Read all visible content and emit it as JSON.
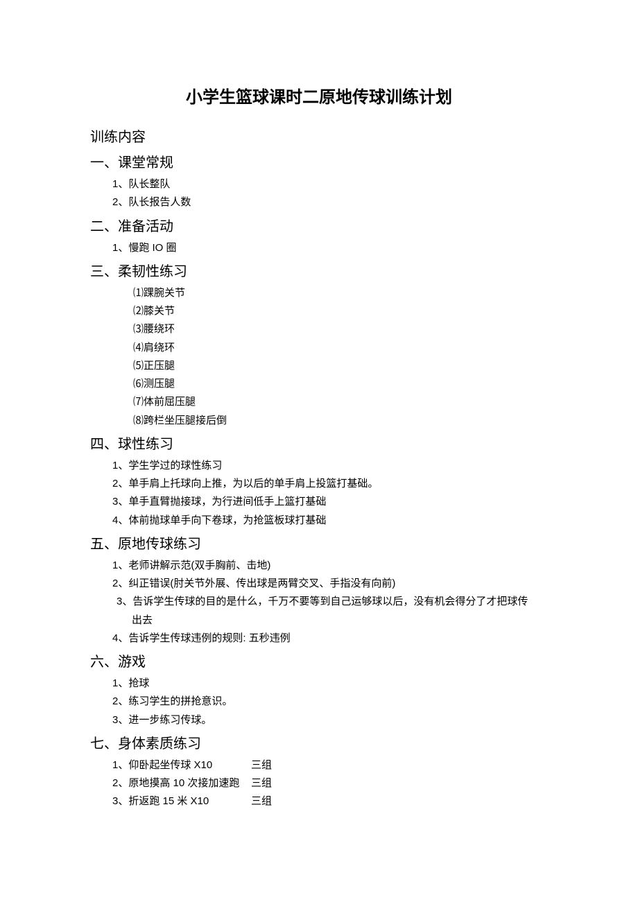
{
  "title": "小学生篮球课时二原地传球训练计划",
  "contentLabel": "训练内容",
  "sections": {
    "s1": {
      "heading": "一、课堂常规",
      "items": [
        "1、队长整队",
        "2、队长报告人数"
      ]
    },
    "s2": {
      "heading": "二、准备活动",
      "items": [
        "1、慢跑 IO 圈"
      ]
    },
    "s3": {
      "heading": "三、柔韧性练习",
      "subitems": [
        "⑴踝腕关节",
        "⑵膝关节",
        "⑶腰绕环",
        "⑷肩绕环",
        "⑸正压腿",
        "⑹测压腿",
        "⑺体前屈压腿",
        "⑻跨栏坐压腿接后倒"
      ]
    },
    "s4": {
      "heading": "四、球性练习",
      "items": [
        "1、学生学过的球性练习",
        "2、单手肩上托球向上推，为以后的单手肩上投篮打基础。",
        "3、单手直臂抛接球，为行进间低手上篮打基础",
        "4、体前抛球单手向下卷球，为抢篮板球打基础"
      ]
    },
    "s5": {
      "heading": "五、原地传球练习",
      "item1": "1、老师讲解示范(双手胸前、击地)",
      "item2": "2、纠正错误(肘关节外展、传出球是两臂交叉、手指没有向前)",
      "item3a": "3、告诉学生传球的目的是什么，千万不要等到自己运够球以后，没有机会得分了才把球传",
      "item3b": "出去",
      "item4": "4、告诉学生传球违例的规则: 五秒违例"
    },
    "s6": {
      "heading": "六、游戏",
      "items": [
        "1、抢球",
        "2、练习学生的拼抢意识。",
        "3、进一步练习传球。"
      ]
    },
    "s7": {
      "heading": "七、身体素质练习",
      "rows": [
        {
          "left": "1、仰卧起坐传球 X10",
          "right": "三组"
        },
        {
          "left": "2、原地摸高 10 次接加速跑",
          "right": "三组"
        },
        {
          "left": "3、折返跑 15 米 X10",
          "right": "三组"
        }
      ]
    }
  }
}
